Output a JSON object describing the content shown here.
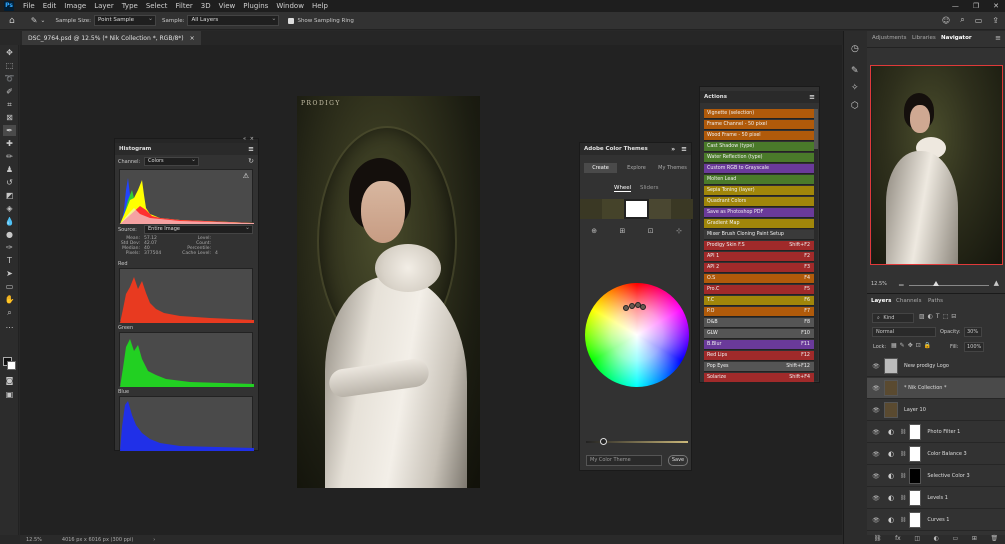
{
  "menu": {
    "items": [
      "File",
      "Edit",
      "Image",
      "Layer",
      "Type",
      "Select",
      "Filter",
      "3D",
      "View",
      "Plugins",
      "Window",
      "Help"
    ]
  },
  "options": {
    "sample_size_label": "Sample Size:",
    "sample_size_value": "Point Sample",
    "sample_label": "Sample:",
    "sample_value": "All Layers",
    "ring_label": "Show Sampling Ring"
  },
  "document": {
    "tab_title": "DSC_9764.psd @ 12.5% (* Nik Collection *, RGB/8*)",
    "watermark": "PRODIGY",
    "zoom": "12.5%",
    "dimensions": "4016 px x 6016 px (300 ppi)"
  },
  "histogram": {
    "title": "Histogram",
    "channel_label": "Channel:",
    "channel_value": "Colors",
    "source_label": "Source:",
    "source_value": "Entire Image",
    "stats_left": [
      "Mean:",
      "Std Dev:",
      "Median:",
      "Pixels:"
    ],
    "stats_left_values": [
      "57.12",
      "42.07",
      "40",
      "377504"
    ],
    "stats_right": [
      "Level:",
      "Count:",
      "Percentile:",
      "Cache Level:"
    ],
    "stats_right_values": [
      "",
      "",
      "",
      "4"
    ],
    "channels": [
      "Red",
      "Green",
      "Blue"
    ]
  },
  "color_themes": {
    "title": "Adobe Color Themes",
    "tabs": [
      "Create",
      "Explore",
      "My Themes"
    ],
    "subtabs": [
      "Wheel",
      "Sliders"
    ],
    "theme_placeholder": "My Color Theme",
    "save_label": "Save"
  },
  "actions": {
    "title": "Actions",
    "items": [
      {
        "name": "Vignette (selection)",
        "key": "",
        "color": "#b05a0a"
      },
      {
        "name": "Frame Channel - 50 pixel",
        "key": "",
        "color": "#b05a0a"
      },
      {
        "name": "Wood Frame - 50 pixel",
        "key": "",
        "color": "#b05a0a"
      },
      {
        "name": "Cast Shadow (type)",
        "key": "",
        "color": "#4a7a2a"
      },
      {
        "name": "Water Reflection (type)",
        "key": "",
        "color": "#4a7a2a"
      },
      {
        "name": "Custom RGB to Grayscale",
        "key": "",
        "color": "#6a3a9a"
      },
      {
        "name": "Molten Lead",
        "key": "",
        "color": "#4a7a2a"
      },
      {
        "name": "Sepia Toning (layer)",
        "key": "",
        "color": "#a0860a"
      },
      {
        "name": "Quadrant Colors",
        "key": "",
        "color": "#a0860a"
      },
      {
        "name": "Save as Photoshop PDF",
        "key": "",
        "color": "#6a3a9a"
      },
      {
        "name": "Gradient Map",
        "key": "",
        "color": "#a0860a"
      },
      {
        "name": "Mixer Brush Cloning Paint Setup",
        "key": "",
        "color": "#3a3a3a"
      },
      {
        "name": "Prodigy Skin F.S",
        "key": "Shift+F2",
        "color": "#a02a2a"
      },
      {
        "name": "API 1",
        "key": "F2",
        "color": "#a02a2a"
      },
      {
        "name": "API 2",
        "key": "F3",
        "color": "#a02a2a"
      },
      {
        "name": "O.S",
        "key": "F4",
        "color": "#b05a0a"
      },
      {
        "name": "Pro.C",
        "key": "F5",
        "color": "#a02a2a"
      },
      {
        "name": "T.C",
        "key": "F6",
        "color": "#a0860a"
      },
      {
        "name": "P.O",
        "key": "F7",
        "color": "#b05a0a"
      },
      {
        "name": "D&B",
        "key": "F8",
        "color": "#555555"
      },
      {
        "name": "GLW",
        "key": "F10",
        "color": "#555555"
      },
      {
        "name": "B.Blur",
        "key": "F11",
        "color": "#6a3a9a"
      },
      {
        "name": "Red Lips",
        "key": "F12",
        "color": "#a02a2a"
      },
      {
        "name": "Pop Eyes",
        "key": "Shift+F12",
        "color": "#555555"
      },
      {
        "name": "Solarize",
        "key": "Shift+F4",
        "color": "#a02a2a"
      }
    ]
  },
  "right_panel": {
    "tabs": [
      "Adjustments",
      "Libraries",
      "Navigator"
    ],
    "nav_zoom": "12.5%",
    "layer_tabs": [
      "Layers",
      "Channels",
      "Paths"
    ],
    "kind_label": "Kind",
    "blend_mode": "Normal",
    "opacity_label": "Opacity:",
    "opacity_value": "30%",
    "lock_label": "Lock:",
    "fill_label": "Fill:",
    "fill_value": "100%",
    "layers": [
      {
        "name": "New prodigy Logo",
        "thumb": "#bbbbbb",
        "mask": ""
      },
      {
        "name": "* Nik Collection *",
        "thumb": "#5a4a30",
        "mask": ""
      },
      {
        "name": "Layer 10",
        "thumb": "#5a4a30",
        "mask": ""
      },
      {
        "name": "Photo Filter 1",
        "thumb": "",
        "mask": "#ffffff"
      },
      {
        "name": "Color Balance 3",
        "thumb": "",
        "mask": "#ffffff"
      },
      {
        "name": "Selective Color 3",
        "thumb": "",
        "mask": "#000000"
      },
      {
        "name": "Levels 1",
        "thumb": "",
        "mask": "#ffffff"
      },
      {
        "name": "Curves 1",
        "thumb": "",
        "mask": "#ffffff"
      }
    ]
  },
  "colors": {
    "navigator_frame": "#e03a3a",
    "selected_layer": "#4a4a4a"
  }
}
